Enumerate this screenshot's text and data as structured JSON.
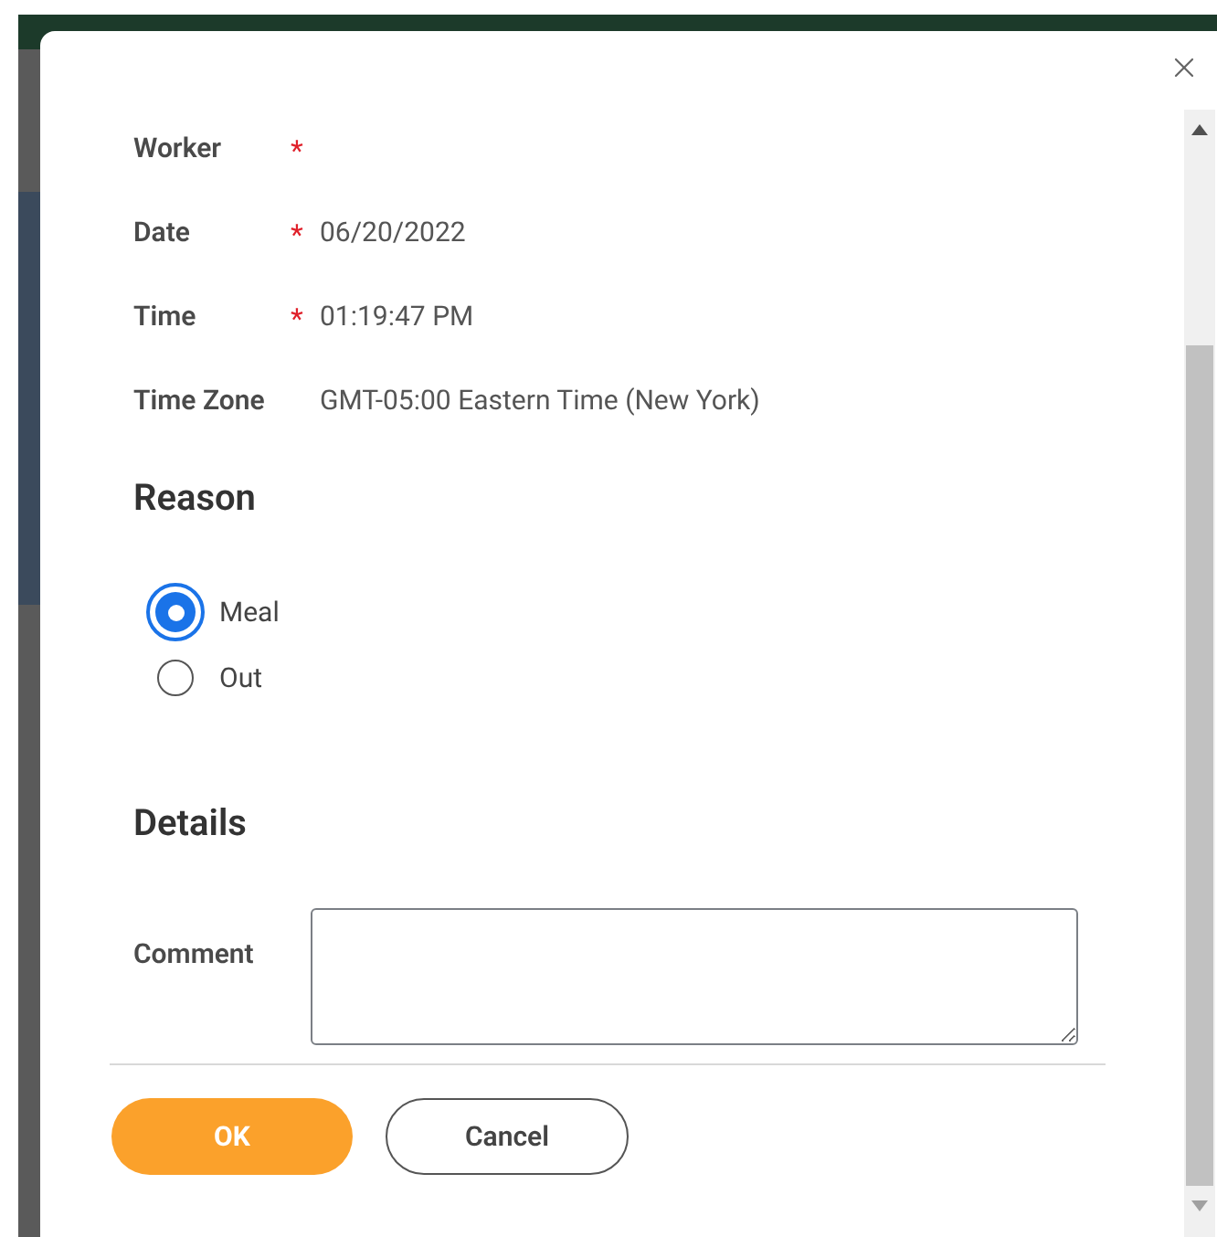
{
  "fields": [
    {
      "label": "Worker",
      "required": true
    },
    {
      "label": "Date",
      "required": true,
      "value": "06/20/2022"
    },
    {
      "label": "Time",
      "required": true,
      "value": "01:19:47 PM"
    },
    {
      "label": "Time Zone",
      "required": false,
      "value": "GMT-05:00 Eastern Time (New York)"
    }
  ],
  "required_mark": "*",
  "reason": {
    "heading": "Reason",
    "options": [
      {
        "label": "Meal",
        "selected": true
      },
      {
        "label": "Out",
        "selected": false
      }
    ]
  },
  "details": {
    "heading": "Details",
    "comment_label": "Comment"
  },
  "buttons": [
    {
      "label": "OK",
      "kind": "primary"
    },
    {
      "label": "Cancel",
      "kind": "secondary"
    }
  ]
}
